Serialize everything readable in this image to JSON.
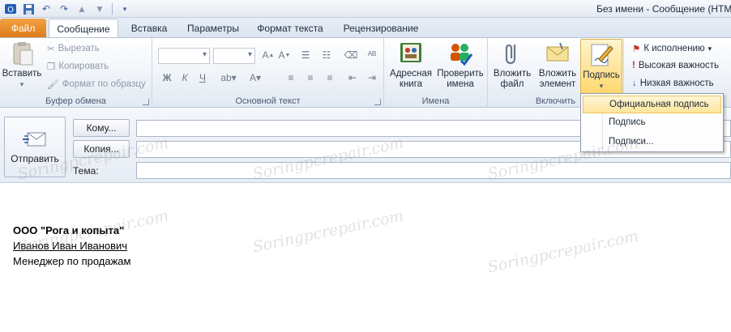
{
  "window": {
    "title": "Без имени  -  Сообщение (HTML)"
  },
  "tabs": [
    {
      "label": "Файл"
    },
    {
      "label": "Сообщение"
    },
    {
      "label": "Вставка"
    },
    {
      "label": "Параметры"
    },
    {
      "label": "Формат текста"
    },
    {
      "label": "Рецензирование"
    }
  ],
  "ribbon": {
    "clipboard": {
      "label": "Буфер обмена",
      "paste": "Вставить",
      "cut": "Вырезать",
      "copy": "Копировать",
      "format_painter": "Формат по образцу"
    },
    "basic_text": {
      "label": "Основной текст",
      "bold": "Ж",
      "italic": "К",
      "underline": "Ч"
    },
    "names": {
      "label": "Имена",
      "address_book_l1": "Адресная",
      "address_book_l2": "книга",
      "check_names_l1": "Проверить",
      "check_names_l2": "имена"
    },
    "include": {
      "label": "Включить",
      "attach_file_l1": "Вложить",
      "attach_file_l2": "файл",
      "attach_item_l1": "Вложить",
      "attach_item_l2": "элемент",
      "signature": "Подпись"
    },
    "tags": {
      "follow_up": "К исполнению",
      "high_importance": "Высокая важность",
      "low_importance": "Низкая важность"
    }
  },
  "signature_menu": {
    "items": [
      "Официальная подпись",
      "Подпись",
      "Подписи..."
    ]
  },
  "header": {
    "send": "Отправить",
    "to": "Кому...",
    "cc": "Копия...",
    "subject": "Тема:"
  },
  "body": {
    "company": "ООО \"Рога и копыта\"",
    "name": "Иванов Иван Иванович",
    "position": "Менеджер по продажам"
  },
  "watermark": "Soringpcrepair.com",
  "colors": {
    "file_tab": "#e3861f",
    "highlight": "#ffe59a",
    "accent": "#3a5f9a"
  }
}
